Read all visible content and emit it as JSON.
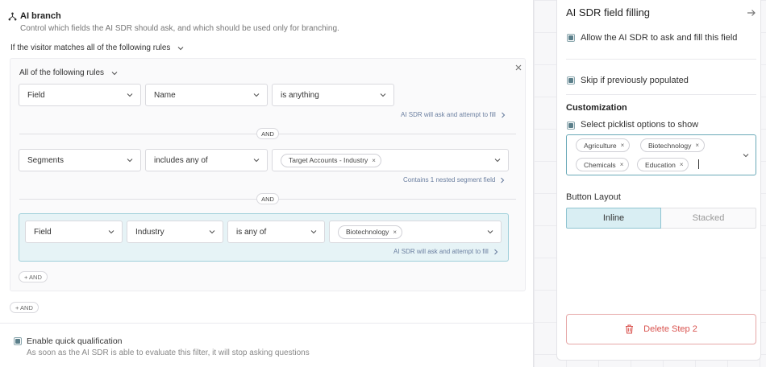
{
  "branch": {
    "title": "AI branch",
    "subtitle": "Control which fields the AI SDR should ask, and which should be used only for branching.",
    "match_label": "If the visitor matches all of the following rules",
    "group_label": "All of the following rules",
    "and_label": "AND",
    "add_and_label": "+ AND",
    "rules": [
      {
        "field": "Field",
        "target": "Name",
        "operator": "is anything",
        "hint": "AI SDR will ask and attempt to fill"
      },
      {
        "field": "Segments",
        "operator": "includes any of",
        "value_chip": "Target Accounts - Industry",
        "hint": "Contains 1 nested segment field"
      },
      {
        "field": "Field",
        "target": "Industry",
        "operator": "is any of",
        "value_chip": "Biotechnology",
        "hint": "AI SDR will ask and attempt to fill"
      }
    ],
    "quick_qualification": {
      "label": "Enable quick qualification",
      "description": "As soon as the AI SDR is able to evaluate this filter, it will stop asking questions",
      "checked": true
    }
  },
  "panel": {
    "title": "AI SDR field filling",
    "allow_label": "Allow the AI SDR to ask and fill this field",
    "skip_label": "Skip if previously populated",
    "customization_heading": "Customization",
    "picklist_label": "Select picklist options to show",
    "picklist_options": [
      "Agriculture",
      "Biotechnology",
      "Chemicals",
      "Education"
    ],
    "button_layout_heading": "Button Layout",
    "layout_options": [
      "Inline",
      "Stacked"
    ],
    "selected_layout": "Inline",
    "delete_label": "Delete Step 2"
  },
  "colors": {
    "accent": "#5b7f8a",
    "highlight_bg": "#e6f3f6",
    "danger": "#d9534f"
  },
  "icons": {
    "branch": "branch-icon",
    "chevron": "chevron-down-icon",
    "close": "close-icon",
    "arrow": "arrow-right-icon",
    "trash": "trash-icon",
    "chevron_right": "chevron-right-icon"
  }
}
